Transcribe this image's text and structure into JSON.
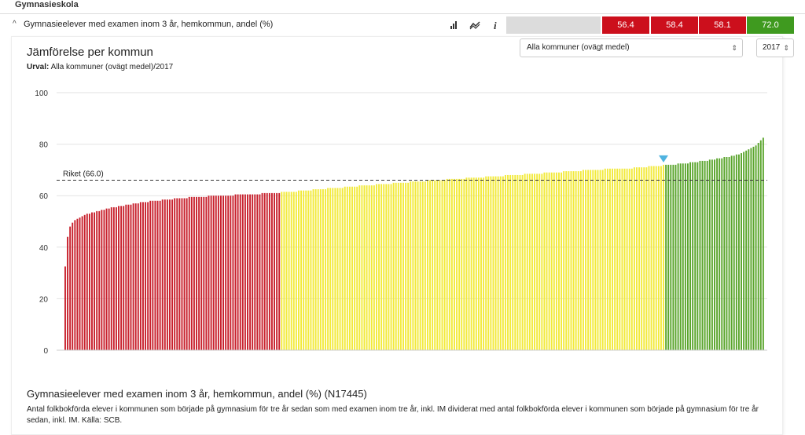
{
  "section": {
    "title": "Gymnasieskola"
  },
  "indicator": {
    "label": "Gymnasieelever med examen inom 3 år, hemkommun, andel (%)",
    "caret": "^",
    "values": [
      {
        "text": "56.4",
        "color": "#cc0f1c"
      },
      {
        "text": "58.4",
        "color": "#cc0f1c"
      },
      {
        "text": "58.1",
        "color": "#cc0f1c"
      },
      {
        "text": "72.0",
        "color": "#3f9a1f"
      }
    ]
  },
  "chart_header": {
    "title": "Jämförelse per kommun",
    "urval_label": "Urval:",
    "urval_value": "Alla kommuner (ovägt medel)/2017"
  },
  "controls": {
    "region_select": "Alla kommuner (ovägt medel)",
    "year_select": "2017",
    "arrow": "⇕"
  },
  "chart_data": {
    "type": "bar",
    "title": "Jämförelse per kommun",
    "ylim": [
      0,
      100
    ],
    "yticks": [
      "0",
      "20",
      "40",
      "60",
      "80",
      "100"
    ],
    "reference_line": {
      "label": "Riket (66.0)",
      "value": 66.0
    },
    "sorted_ascending": true,
    "n_bars": 290,
    "highlight_marker_value": 72.0,
    "colors": {
      "low": "#c8202c",
      "mid": "#f2ea3a",
      "high": "#5aa52c"
    },
    "category_counts": {
      "low": 89,
      "mid": 158,
      "high": 43
    },
    "values": [
      32.5,
      44.0,
      48.0,
      49.5,
      50.5,
      51.0,
      51.5,
      52.0,
      52.5,
      53.0,
      53.0,
      53.5,
      53.5,
      54.0,
      54.0,
      54.5,
      54.5,
      55.0,
      55.0,
      55.5,
      55.5,
      55.5,
      56.0,
      56.0,
      56.0,
      56.5,
      56.5,
      56.5,
      57.0,
      57.0,
      57.0,
      57.5,
      57.5,
      57.5,
      57.5,
      58.0,
      58.0,
      58.0,
      58.0,
      58.0,
      58.5,
      58.5,
      58.5,
      58.5,
      58.5,
      59.0,
      59.0,
      59.0,
      59.0,
      59.0,
      59.0,
      59.5,
      59.5,
      59.5,
      59.5,
      59.5,
      59.5,
      59.5,
      59.5,
      60.0,
      60.0,
      60.0,
      60.0,
      60.0,
      60.0,
      60.0,
      60.0,
      60.0,
      60.0,
      60.0,
      60.5,
      60.5,
      60.5,
      60.5,
      60.5,
      60.5,
      60.5,
      60.5,
      60.5,
      60.5,
      60.5,
      61.0,
      61.0,
      61.0,
      61.0,
      61.0,
      61.0,
      61.0,
      61.0,
      61.5,
      61.5,
      61.5,
      61.5,
      61.5,
      61.5,
      61.5,
      62.0,
      62.0,
      62.0,
      62.0,
      62.0,
      62.0,
      62.5,
      62.5,
      62.5,
      62.5,
      62.5,
      62.5,
      63.0,
      63.0,
      63.0,
      63.0,
      63.0,
      63.0,
      63.0,
      63.5,
      63.5,
      63.5,
      63.5,
      63.5,
      63.5,
      64.0,
      64.0,
      64.0,
      64.0,
      64.0,
      64.0,
      64.0,
      64.5,
      64.5,
      64.5,
      64.5,
      64.5,
      64.5,
      64.5,
      65.0,
      65.0,
      65.0,
      65.0,
      65.0,
      65.0,
      65.0,
      65.5,
      65.5,
      65.5,
      65.5,
      65.5,
      65.5,
      65.5,
      66.0,
      66.0,
      66.0,
      66.0,
      66.0,
      66.0,
      66.0,
      66.0,
      66.5,
      66.5,
      66.5,
      66.5,
      66.5,
      66.5,
      66.5,
      66.5,
      67.0,
      67.0,
      67.0,
      67.0,
      67.0,
      67.0,
      67.0,
      67.0,
      67.5,
      67.5,
      67.5,
      67.5,
      67.5,
      67.5,
      67.5,
      67.5,
      68.0,
      68.0,
      68.0,
      68.0,
      68.0,
      68.0,
      68.0,
      68.0,
      68.5,
      68.5,
      68.5,
      68.5,
      68.5,
      68.5,
      68.5,
      68.5,
      69.0,
      69.0,
      69.0,
      69.0,
      69.0,
      69.0,
      69.0,
      69.0,
      69.5,
      69.5,
      69.5,
      69.5,
      69.5,
      69.5,
      69.5,
      69.5,
      70.0,
      70.0,
      70.0,
      70.0,
      70.0,
      70.0,
      70.0,
      70.0,
      70.0,
      70.5,
      70.5,
      70.5,
      70.5,
      70.5,
      70.5,
      70.5,
      70.5,
      70.5,
      70.5,
      70.5,
      70.5,
      71.0,
      71.0,
      71.0,
      71.0,
      71.0,
      71.0,
      71.5,
      71.5,
      71.5,
      71.5,
      71.5,
      71.5,
      72.0,
      72.0,
      72.0,
      72.0,
      72.0,
      72.0,
      72.5,
      72.5,
      72.5,
      72.5,
      72.5,
      73.0,
      73.0,
      73.0,
      73.0,
      73.5,
      73.5,
      73.5,
      73.5,
      74.0,
      74.0,
      74.0,
      74.5,
      74.5,
      74.5,
      75.0,
      75.0,
      75.0,
      75.5,
      75.5,
      76.0,
      76.0,
      76.5,
      77.0,
      77.5,
      78.0,
      78.5,
      79.0,
      79.5,
      80.5,
      81.5,
      82.5
    ]
  },
  "footer": {
    "title": "Gymnasieelever med examen inom 3 år, hemkommun, andel (%) (N17445)",
    "description": "Antal folkbokförda elever i kommunen som började på gymnasium för tre år sedan som med examen inom tre år, inkl. IM dividerat med antal folkbokförda elever i kommunen som började på gymnasium för tre år sedan, inkl. IM. Källa: SCB."
  }
}
